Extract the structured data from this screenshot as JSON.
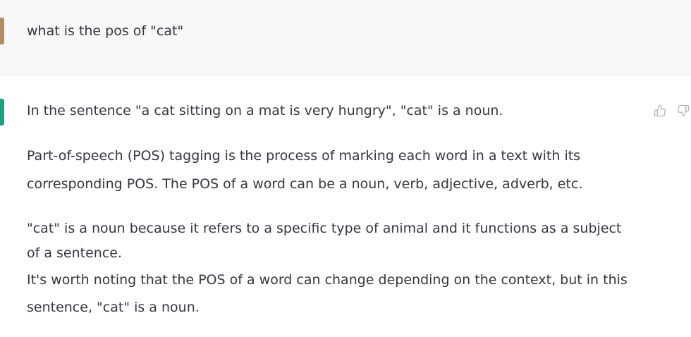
{
  "user_message": {
    "text": "what is the pos of \"cat\""
  },
  "assistant_message": {
    "paragraphs": [
      {
        "lines": [
          "In the sentence \"a cat sitting on a mat is very hungry\", \"cat\" is a noun."
        ]
      },
      {
        "lines": [
          "Part-of-speech (POS) tagging is the process of marking each word in a text with its",
          "corresponding POS. The POS of a word can be a noun, verb, adjective, adverb, etc."
        ]
      },
      {
        "lines": [
          "\"cat\" is a noun because it refers to a specific type of animal and it functions as a subject",
          "of a sentence.",
          "It's worth noting that the POS of a word can change depending on the context, but in this",
          "sentence, \"cat\" is a noun."
        ]
      }
    ],
    "feedback": {
      "thumbs_up_icon": "thumbs-up-icon",
      "thumbs_down_icon": "thumbs-down-icon"
    }
  },
  "colors": {
    "user_avatar": "#b38b5d",
    "assistant_avatar": "#19a37f",
    "user_row_background": "#f8f8f9",
    "assistant_row_background": "#ffffff",
    "text": "#353740",
    "icon": "#b4b4b8",
    "divider": "#e4e4e7"
  }
}
